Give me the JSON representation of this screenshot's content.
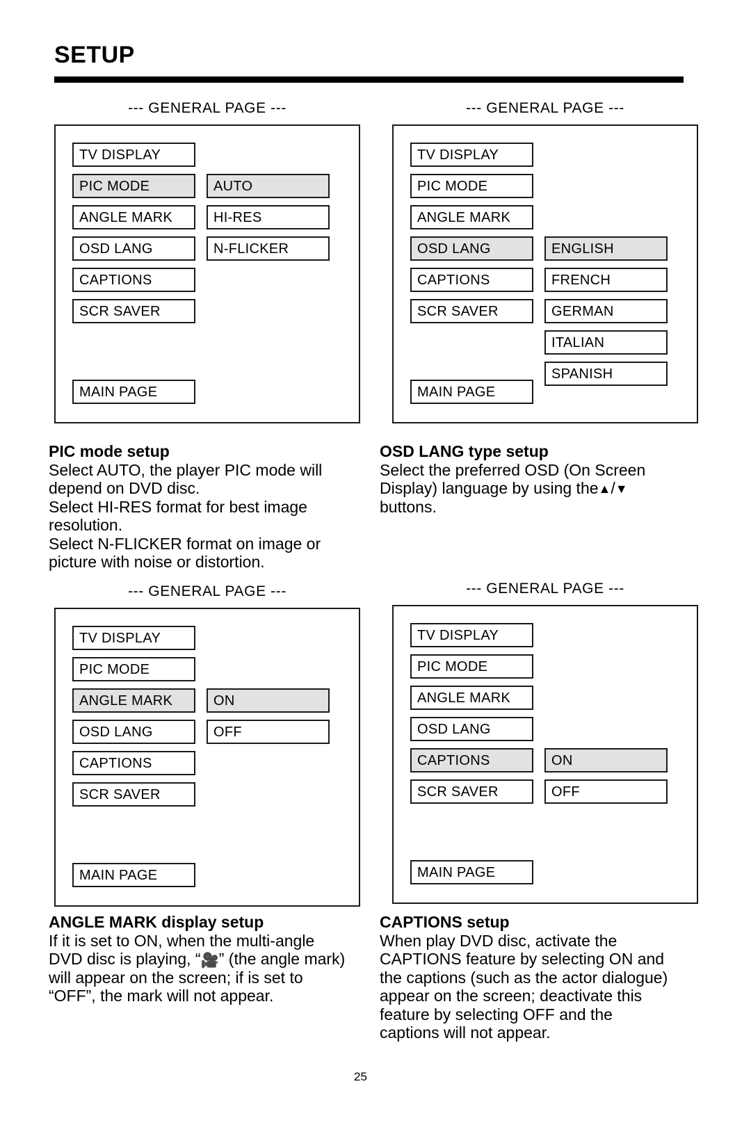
{
  "header": {
    "title": "SETUP"
  },
  "page_number": "25",
  "screens": [
    {
      "id": "pic-mode",
      "caption": "--- GENERAL PAGE ---",
      "menu_items": [
        {
          "label": "TV DISPLAY",
          "selected": false
        },
        {
          "label": "PIC MODE",
          "selected": true
        },
        {
          "label": "ANGLE MARK",
          "selected": false
        },
        {
          "label": "OSD LANG",
          "selected": false
        },
        {
          "label": "CAPTIONS",
          "selected": false
        },
        {
          "label": "SCR SAVER",
          "selected": false
        }
      ],
      "main_page_label": "MAIN PAGE",
      "value_start_index": 1,
      "values": [
        {
          "label": "AUTO",
          "selected": true
        },
        {
          "label": "HI-RES",
          "selected": false
        },
        {
          "label": "N-FLICKER",
          "selected": false
        }
      ]
    },
    {
      "id": "osd-lang",
      "caption": "--- GENERAL PAGE ---",
      "menu_items": [
        {
          "label": "TV DISPLAY",
          "selected": false
        },
        {
          "label": "PIC MODE",
          "selected": false
        },
        {
          "label": "ANGLE MARK",
          "selected": false
        },
        {
          "label": "OSD LANG",
          "selected": true
        },
        {
          "label": "CAPTIONS",
          "selected": false
        },
        {
          "label": "SCR SAVER",
          "selected": false
        }
      ],
      "main_page_label": "MAIN PAGE",
      "value_start_index": 3,
      "values": [
        {
          "label": "ENGLISH",
          "selected": true
        },
        {
          "label": "FRENCH",
          "selected": false
        },
        {
          "label": "GERMAN",
          "selected": false
        },
        {
          "label": "ITALIAN",
          "selected": false
        },
        {
          "label": "SPANISH",
          "selected": false
        }
      ]
    },
    {
      "id": "angle-mark",
      "caption": "--- GENERAL PAGE ---",
      "menu_items": [
        {
          "label": "TV DISPLAY",
          "selected": false
        },
        {
          "label": "PIC MODE",
          "selected": false
        },
        {
          "label": "ANGLE MARK",
          "selected": true
        },
        {
          "label": "OSD LANG",
          "selected": false
        },
        {
          "label": "CAPTIONS",
          "selected": false
        },
        {
          "label": "SCR SAVER",
          "selected": false
        }
      ],
      "main_page_label": "MAIN PAGE",
      "value_start_index": 2,
      "values": [
        {
          "label": "ON",
          "selected": true
        },
        {
          "label": "OFF",
          "selected": false
        }
      ]
    },
    {
      "id": "captions",
      "caption": "--- GENERAL PAGE ---",
      "menu_items": [
        {
          "label": "TV DISPLAY",
          "selected": false
        },
        {
          "label": "PIC MODE",
          "selected": false
        },
        {
          "label": "ANGLE MARK",
          "selected": false
        },
        {
          "label": "OSD LANG",
          "selected": false
        },
        {
          "label": "CAPTIONS",
          "selected": true
        },
        {
          "label": "SCR SAVER",
          "selected": false
        }
      ],
      "main_page_label": "MAIN PAGE",
      "value_start_index": 4,
      "values": [
        {
          "label": "ON",
          "selected": true
        },
        {
          "label": "OFF",
          "selected": false
        }
      ]
    }
  ],
  "sections": {
    "pic_mode": {
      "heading": "PIC mode setup",
      "line1": "Select AUTO, the player PIC mode will",
      "line2": "depend on DVD disc.",
      "line3": "Select HI-RES format for best image",
      "line4": "resolution.",
      "line5": "Select N-FLICKER format on image or",
      "line6": "picture with noise or distortion."
    },
    "osd_lang": {
      "heading": "OSD LANG type setup",
      "line1": "Select the preferred OSD (On Screen",
      "line2a": "Display) language by using the",
      "arrow_up": "▲",
      "separator": "/",
      "arrow_down": "▼",
      "line3": "buttons."
    },
    "angle_mark": {
      "heading": "ANGLE MARK display setup",
      "line1": "If it is set to ON, when the multi-angle",
      "line2a": "DVD disc is playing, “",
      "glyph": "🎥",
      "line2b": "” (the angle mark)",
      "line3": "will appear on the screen; if is set to",
      "line4": "“OFF”, the mark will not appear."
    },
    "captions": {
      "heading": "CAPTIONS setup",
      "line1": "When play DVD disc, activate the",
      "line2": "CAPTIONS feature by selecting ON and",
      "line3": "the captions (such as the actor dialogue)",
      "line4": "appear on the screen; deactivate this",
      "line5": "feature by selecting OFF and the",
      "line6": "captions will not appear."
    }
  }
}
